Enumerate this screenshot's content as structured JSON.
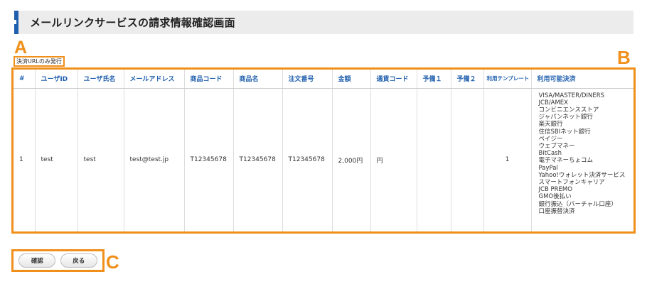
{
  "header": {
    "title": "メールリンクサービスの請求情報確認画面"
  },
  "markers": {
    "a": "A",
    "b": "B",
    "c": "C"
  },
  "url_only_label": "決済URLのみ発行",
  "table": {
    "headers": [
      "#",
      "ユーザID",
      "ユーザ氏名",
      "メールアドレス",
      "商品コード",
      "商品名",
      "注文番号",
      "金額",
      "通貨コード",
      "予備１",
      "予備２",
      "利用テンプレート",
      "利用可能決済"
    ],
    "row": {
      "no": "1",
      "user_id": "test",
      "user_name": "test",
      "email": "test@test.jp",
      "product_code": "T12345678",
      "product_name": "T12345678",
      "order_no": "T12345678",
      "amount": "2,000円",
      "currency": "円",
      "reserve1": "",
      "reserve2": "",
      "template": "1",
      "payment_methods": [
        "VISA/MASTER/DINERS",
        "JCB/AMEX",
        "コンビニエンスストア",
        "ジャパンネット銀行",
        "楽天銀行",
        "住信SBIネット銀行",
        "ペイジー",
        "ウェブマネー",
        "BitCash",
        "電子マネーちょコム",
        "PayPal",
        "Yahoo!ウォレット決済サービス",
        "スマートフォンキャリア",
        "JCB PREMO",
        "GMO後払い",
        "銀行振込（バーチャル口座）",
        "口座振替決済"
      ]
    }
  },
  "buttons": {
    "confirm": "確認",
    "back": "戻る"
  },
  "colors": {
    "accent": "#f0901a",
    "brand": "#1f5fae",
    "header_bg": "#ececec"
  }
}
